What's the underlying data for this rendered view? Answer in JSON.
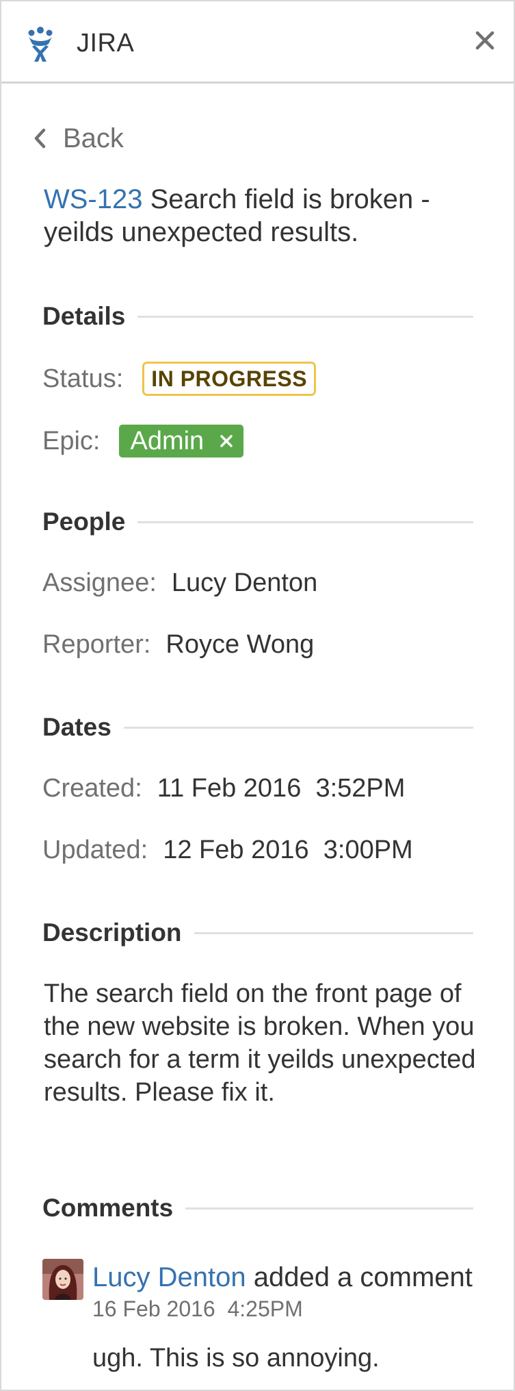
{
  "header": {
    "app_title": "JIRA",
    "logo_icon": "jira-logo-icon",
    "close_icon": "close-icon"
  },
  "nav": {
    "back_label": "Back",
    "back_icon": "chevron-left-icon"
  },
  "issue": {
    "key": "WS-123",
    "summary": "Search field is broken - yeilds unexpected results."
  },
  "details": {
    "heading": "Details",
    "status_label": "Status:",
    "status_value": "IN PROGRESS",
    "status_color": "#f0c44a",
    "epic_label": "Epic:",
    "epic_value": "Admin",
    "epic_color": "#5aa84a"
  },
  "people": {
    "heading": "People",
    "assignee_label": "Assignee:",
    "assignee_value": "Lucy Denton",
    "reporter_label": "Reporter:",
    "reporter_value": "Royce Wong"
  },
  "dates": {
    "heading": "Dates",
    "created_label": "Created:",
    "created_value": "11 Feb 2016  3:52PM",
    "updated_label": "Updated:",
    "updated_value": "12 Feb 2016  3:00PM"
  },
  "description": {
    "heading": "Description",
    "text": "The search field on the front page of the new website is broken. When you search for a term it yeilds unexpected results. Please fix it."
  },
  "comments": {
    "heading": "Comments",
    "items": [
      {
        "author": "Lucy Denton",
        "action": " added a comment",
        "date": "16 Feb 2016  4:25PM",
        "body": "ugh. This is so annoying."
      }
    ]
  },
  "colors": {
    "link": "#3572b0",
    "muted": "#707070",
    "text": "#333333"
  }
}
